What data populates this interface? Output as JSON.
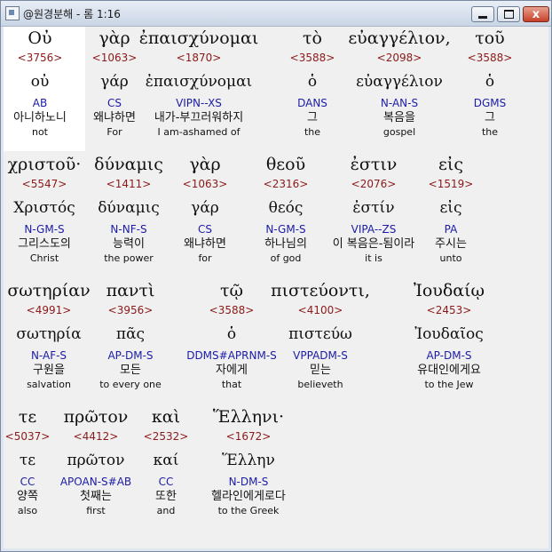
{
  "window": {
    "title": "@원경분해 - 롬 1:16",
    "close_glyph": "x"
  },
  "rows": [
    [
      {
        "greek": "Οὐ",
        "strong": "<3756>",
        "lemma": "οὐ",
        "parse": "AB",
        "korean": "아니하노니",
        "english": "not"
      },
      {
        "greek": "γὰρ",
        "strong": "<1063>",
        "lemma": "γάρ",
        "parse": "CS",
        "korean": "왜냐하면",
        "english": "For"
      },
      {
        "greek": "ἐπαισχύνομαι",
        "strong": "<1870>",
        "lemma": "ἐπαισχύνομαι",
        "parse": "VIPN--XS",
        "korean": "내가-부끄러워하지",
        "english": "I am-ashamed of"
      },
      {
        "greek": "τὸ",
        "strong": "<3588>",
        "lemma": "ὁ",
        "parse": "DANS",
        "korean": "그",
        "english": "the"
      },
      {
        "greek": "εὐαγγέλιον,",
        "strong": "<2098>",
        "lemma": "εὐαγγέλιον",
        "parse": "N-AN-S",
        "korean": "복음을",
        "english": "gospel"
      },
      {
        "greek": "τοῦ",
        "strong": "<3588>",
        "lemma": "ὁ",
        "parse": "DGMS",
        "korean": "그",
        "english": "the"
      }
    ],
    [
      {
        "greek": "χριστοῦ·",
        "strong": "<5547>",
        "lemma": "Χριστός",
        "parse": "N-GM-S",
        "korean": "그리스도의",
        "english": "Christ"
      },
      {
        "greek": "δύναμις",
        "strong": "<1411>",
        "lemma": "δύναμις",
        "parse": "N-NF-S",
        "korean": "능력이",
        "english": "the power"
      },
      {
        "greek": "γὰρ",
        "strong": "<1063>",
        "lemma": "γάρ",
        "parse": "CS",
        "korean": "왜냐하면",
        "english": "for"
      },
      {
        "greek": "θεοῦ",
        "strong": "<2316>",
        "lemma": "θεός",
        "parse": "N-GM-S",
        "korean": "하나님의",
        "english": "of god"
      },
      {
        "greek": "ἐστιν",
        "strong": "<2076>",
        "lemma": "ἐστίν",
        "parse": "VIPA--ZS",
        "korean": "이 복음은-됨이라",
        "english": "it is"
      },
      {
        "greek": "εἰς",
        "strong": "<1519>",
        "lemma": "εἰς",
        "parse": "PA",
        "korean": "주시는",
        "english": "unto"
      }
    ],
    [
      {
        "greek": "σωτηρίαν",
        "strong": "<4991>",
        "lemma": "σωτηρία",
        "parse": "N-AF-S",
        "korean": "구원을",
        "english": "salvation"
      },
      {
        "greek": "παντὶ",
        "strong": "<3956>",
        "lemma": "πᾶς",
        "parse": "AP-DM-S",
        "korean": "모든",
        "english": "to every one"
      },
      {
        "greek": "τῷ",
        "strong": "<3588>",
        "lemma": "ὁ",
        "parse": "DDMS#APRNM-S",
        "korean": "자에게",
        "english": "that"
      },
      {
        "greek": "πιστεύοντι,",
        "strong": "<4100>",
        "lemma": "πιστεύω",
        "parse": "VPPADM-S",
        "korean": "믿는",
        "english": "believeth"
      },
      {
        "greek": "Ἰουδαίῳ",
        "strong": "<2453>",
        "lemma": "Ἰουδαῖος",
        "parse": "AP-DM-S",
        "korean": "유대인에게요",
        "english": "to the Jew"
      }
    ],
    [
      {
        "greek": "τε",
        "strong": "<5037>",
        "lemma": "τε",
        "parse": "CC",
        "korean": "양쪽",
        "english": "also"
      },
      {
        "greek": "πρῶτον",
        "strong": "<4412>",
        "lemma": "πρῶτον",
        "parse": "APOAN-S#AB",
        "korean": "첫째는",
        "english": "first"
      },
      {
        "greek": "καὶ",
        "strong": "<2532>",
        "lemma": "καί",
        "parse": "CC",
        "korean": "또한",
        "english": "and"
      },
      {
        "greek": "Ἕλληνι·",
        "strong": "<1672>",
        "lemma": "Ἕλλην",
        "parse": "N-DM-S",
        "korean": "헬라인에게로다",
        "english": "to the Greek"
      }
    ]
  ]
}
